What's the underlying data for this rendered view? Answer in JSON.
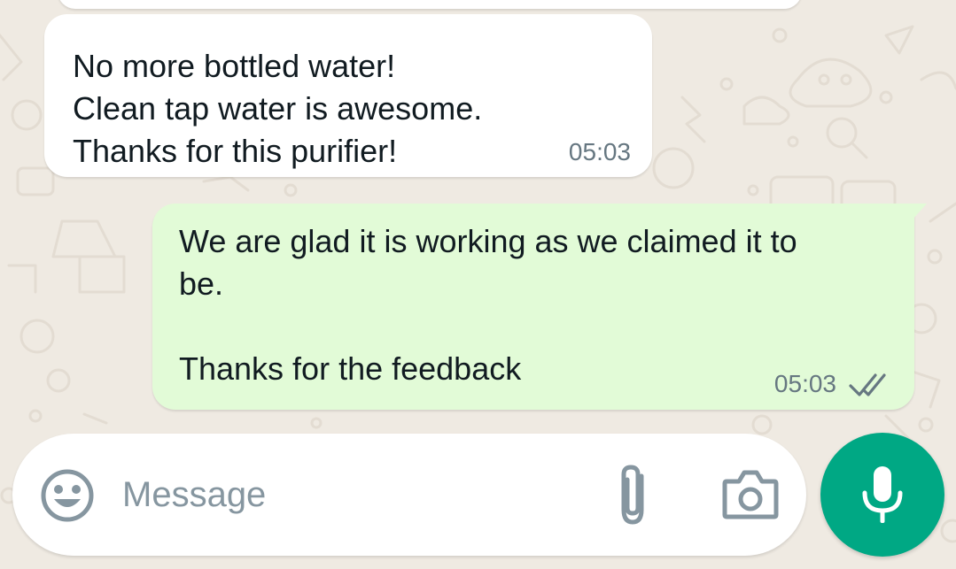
{
  "messages": [
    {
      "direction": "incoming",
      "lines": [
        "No more bottled water!",
        "Clean tap water is awesome.",
        "Thanks for this purifier!"
      ],
      "time": "05:03"
    },
    {
      "direction": "outgoing",
      "lines": [
        "We are glad it is working as we claimed it to",
        "be.",
        "",
        "Thanks for the feedback"
      ],
      "time": "05:03",
      "status_icon": "double-check-icon"
    }
  ],
  "composer": {
    "placeholder": "Message",
    "value": "",
    "emoji_icon": "emoji-icon",
    "attach_icon": "paperclip-icon",
    "camera_icon": "camera-icon",
    "send_icon": "microphone-icon"
  },
  "colors": {
    "background": "#efeae2",
    "incoming_bubble": "#ffffff",
    "outgoing_bubble": "#e2fbd7",
    "accent": "#00a884",
    "timestamp": "#667781",
    "icon_gray": "#8696a0"
  }
}
